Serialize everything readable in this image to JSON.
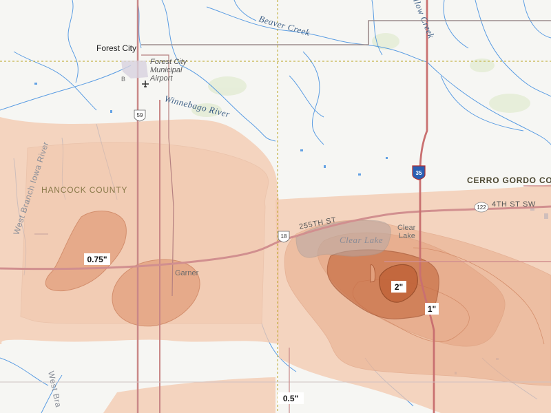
{
  "map": {
    "places": {
      "forest_city": "Forest City",
      "airport_line1": "Forest City",
      "airport_line2": "Municipal",
      "airport_line3": "Airport",
      "garner": "Garner",
      "clear_lake_town_line1": "Clear",
      "clear_lake_town_line2": "Lake"
    },
    "water": {
      "beaver_creek": "Beaver Creek",
      "winnebago_river": "Winnebago River",
      "west_branch_iowa_river": "West Branch Iowa River",
      "west_branch_bottom": "West Bra",
      "clear_lake": "Clear Lake",
      "willow_creek": "llow Creek"
    },
    "counties": {
      "hancock": "HANCOCK COUNTY",
      "cerro_gordo": "CERRO GORDO COU"
    },
    "roads": {
      "street_255th": "255TH ST",
      "street_4th_sw": "4TH ST SW",
      "us_59": "59",
      "us_18": "18",
      "route_122": "122",
      "interstate_35": "35",
      "route_b": "B"
    },
    "contour_labels": {
      "c075": "0.75\"",
      "c2": "2\"",
      "c1": "1\"",
      "c05": "0.5\""
    },
    "colors": {
      "rain_light": "#f3c8ad",
      "rain_mid": "#e4a07c",
      "rain_dark": "#cf7c55",
      "water": "#3f8de0",
      "road": "#c98787"
    }
  }
}
